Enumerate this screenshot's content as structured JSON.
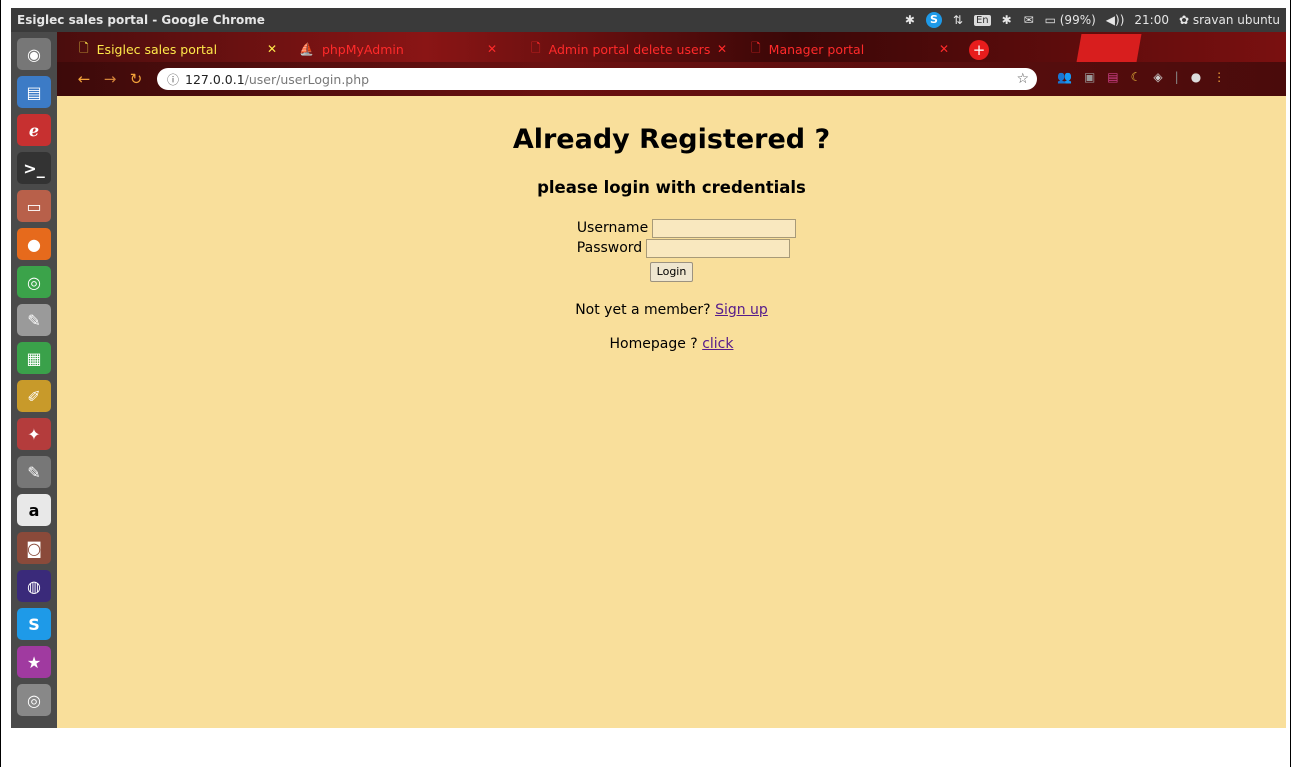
{
  "os_panel": {
    "window_title": "Esiglec sales portal - Google Chrome",
    "tray": {
      "bluetooth": "✱",
      "skype": "S",
      "network": "⇅",
      "keyboard": "En",
      "bluetooth2": "✱",
      "mail": "✉",
      "battery": "▭ (99%)",
      "volume": "◀))",
      "time": "21:00",
      "user": "✿ sravan ubuntu"
    }
  },
  "launcher": {
    "items": [
      {
        "name": "dash",
        "glyph": "◉",
        "color": "#777"
      },
      {
        "name": "files",
        "glyph": "▤",
        "color": "#3c7bc6"
      },
      {
        "name": "acrobat",
        "glyph": "ℯ",
        "color": "#c73030"
      },
      {
        "name": "terminal",
        "glyph": ">_",
        "color": "#333"
      },
      {
        "name": "archive",
        "glyph": "▭",
        "color": "#b8604a"
      },
      {
        "name": "firefox",
        "glyph": "●",
        "color": "#e66a1c"
      },
      {
        "name": "chrome",
        "glyph": "◎",
        "color": "#3ba34a"
      },
      {
        "name": "text-editor",
        "glyph": "✎",
        "color": "#9a9a9a"
      },
      {
        "name": "spreadsheet",
        "glyph": "▦",
        "color": "#3aa14a"
      },
      {
        "name": "pencil",
        "glyph": "✐",
        "color": "#c89a2a"
      },
      {
        "name": "tools",
        "glyph": "✦",
        "color": "#b43c3c"
      },
      {
        "name": "notes",
        "glyph": "✎",
        "color": "#777"
      },
      {
        "name": "amazon",
        "glyph": "a",
        "color": "#e8e8e8"
      },
      {
        "name": "camera",
        "glyph": "◙",
        "color": "#8a4a3a"
      },
      {
        "name": "eclipse",
        "glyph": "◍",
        "color": "#3a2a7a"
      },
      {
        "name": "skype",
        "glyph": "S",
        "color": "#1e9ae8"
      },
      {
        "name": "stars",
        "glyph": "★",
        "color": "#a03aa0"
      },
      {
        "name": "disc",
        "glyph": "◎",
        "color": "#888"
      }
    ]
  },
  "browser": {
    "tabs": [
      {
        "label": "Esiglec sales portal",
        "icon": "🗋"
      },
      {
        "label": "phpMyAdmin",
        "icon": "⛵"
      },
      {
        "label": "Admin portal delete users",
        "icon": "🗋"
      },
      {
        "label": "Manager portal",
        "icon": "🗋"
      }
    ],
    "url_host": "127.0.0.1",
    "url_path": "/user/userLogin.php"
  },
  "page": {
    "heading": "Already Registered ?",
    "subheading": "please login with credentials",
    "username_label": "Username",
    "password_label": "Password",
    "login_button": "Login",
    "signup_prefix": "Not yet a member?",
    "signup_link": "Sign up",
    "home_prefix": "Homepage ?",
    "home_link": "click",
    "background": "#f9df9b"
  }
}
